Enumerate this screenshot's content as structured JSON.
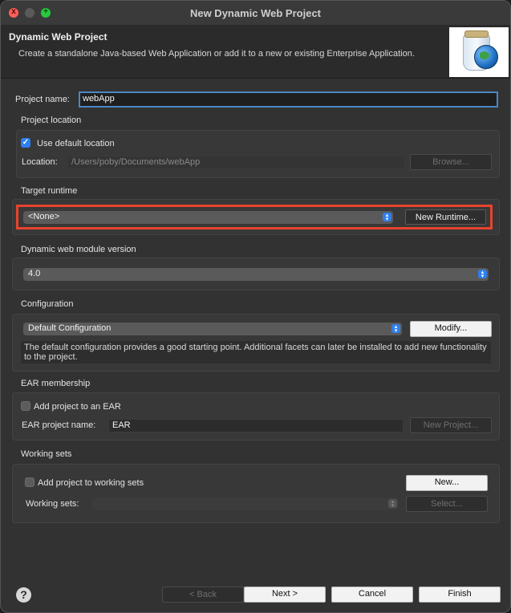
{
  "window": {
    "title": "New Dynamic Web Project"
  },
  "traffic_lights": {
    "close_glyph": "x",
    "maximize_glyph": "+"
  },
  "banner": {
    "title": "Dynamic Web Project",
    "description": "Create a standalone Java-based Web Application or add it to a new or existing Enterprise Application.",
    "image_icon": "jar-globe-icon"
  },
  "project_name": {
    "label": "Project name:",
    "value": "webApp"
  },
  "project_location": {
    "label": "Project location",
    "use_default_label": "Use default location",
    "use_default_checked": true,
    "location_label": "Location:",
    "location_value": "/Users/poby/Documents/webApp",
    "browse_label": "Browse..."
  },
  "target_runtime": {
    "label": "Target runtime",
    "selected": "<None>",
    "new_runtime_label": "New Runtime..."
  },
  "module_version": {
    "label": "Dynamic web module version",
    "selected": "4.0"
  },
  "configuration": {
    "label": "Configuration",
    "selected": "Default Configuration",
    "modify_label": "Modify...",
    "info_text": "The default configuration provides a good starting point. Additional facets can later be installed to add new functionality to the project."
  },
  "ear_membership": {
    "label": "EAR membership",
    "add_label": "Add project to an EAR",
    "add_checked": false,
    "ear_name_label": "EAR project name:",
    "ear_name_value": "EAR",
    "new_project_label": "New Project..."
  },
  "working_sets": {
    "label": "Working sets",
    "add_label": "Add project to working sets",
    "add_checked": false,
    "new_label": "New...",
    "sets_label": "Working sets:",
    "sets_value": "",
    "select_label": "Select..."
  },
  "footer": {
    "help_glyph": "?",
    "back_label": "< Back",
    "next_label": "Next >",
    "cancel_label": "Cancel",
    "finish_label": "Finish"
  },
  "colors": {
    "accent": "#2f7ff1",
    "highlight": "#e8432d"
  }
}
